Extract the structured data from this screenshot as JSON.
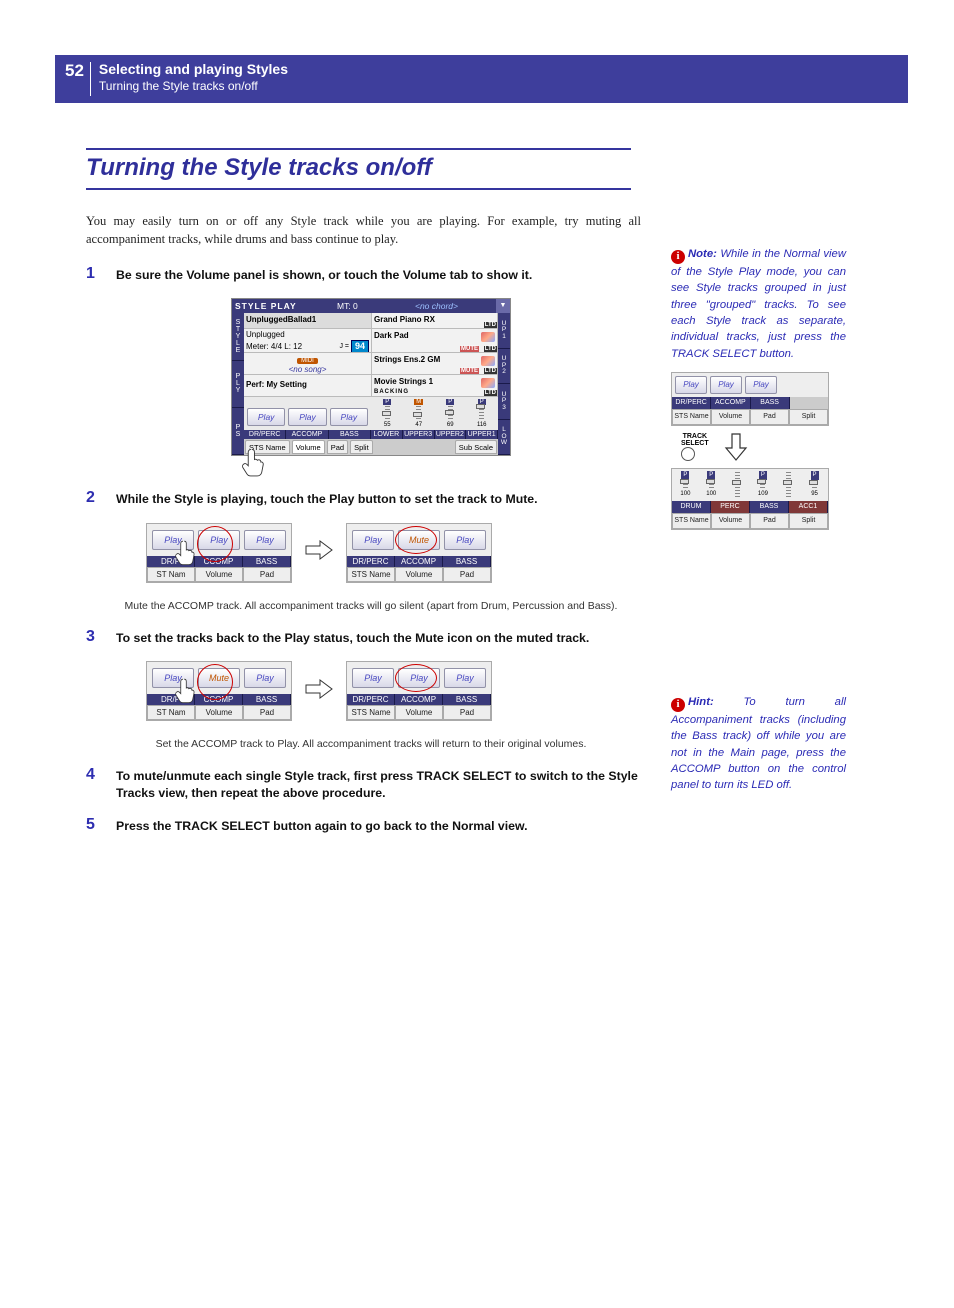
{
  "header": {
    "page_number": "52",
    "section": "Selecting and playing Styles",
    "subsection": "Turning the Style tracks on/off"
  },
  "title": "Turning the Style tracks on/off",
  "intro": "You may easily turn on or off any Style track while you are playing. For example, try muting all accompaniment tracks, while drums and bass continue to play.",
  "steps": {
    "s1": {
      "num": "1",
      "text": "Be sure the Volume panel is shown, or touch the Volume tab to show it."
    },
    "s2": {
      "num": "2",
      "text": "While the Style is playing, touch the Play button to set the track to Mute."
    },
    "s3": {
      "num": "3",
      "text": "To set the tracks back to the Play status, touch the Mute icon on the muted track."
    },
    "s4": {
      "num": "4",
      "text": "To mute/unmute each single Style track, first press TRACK SELECT to switch to the Style Tracks view, then repeat the above procedure."
    },
    "s5": {
      "num": "5",
      "text": "Press the TRACK SELECT button again to go back to the Normal view."
    }
  },
  "captions": {
    "c2": "Mute the ACCOMP track. All accompaniment tracks will go silent (apart from Drum, Percussion and Bass).",
    "c3": "Set the ACCOMP track to Play. All accompaniment tracks will return to their original volumes."
  },
  "side_notes": {
    "note1": {
      "label": "Note:",
      "text": " While in the Normal view of the Style Play mode, you can see Style tracks grouped in just three \"grouped\" tracks. To see each Style track as separate, individual tracks, just press the TRACK SELECT button."
    },
    "hint1": {
      "label": "Hint:",
      "text": " To turn all Accompaniment tracks (including the Bass track) off while you are not in the Main page, press the ACCOMP button on the control panel to turn its LED off."
    }
  },
  "fig1": {
    "title": "STYLE PLAY",
    "mt": "MT: 0",
    "chord": "<no chord>",
    "style_name": "UnpluggedBallad1",
    "meter_l": "Unplugged",
    "meter_line": "Meter: 4/4  L: 12",
    "tempo_prefix": "J =",
    "tempo": "94",
    "no_song": "<no song>",
    "perf": "Perf:  My Setting",
    "sounds": [
      "Grand Piano RX",
      "Dark Pad",
      "Strings Ens.2 GM",
      "Movie Strings 1"
    ],
    "smallsub": "BACKING",
    "play": "Play",
    "group_labels": [
      "DR/PERC",
      "ACCOMP",
      "BASS"
    ],
    "upper_labels": [
      "LOWER",
      "UPPER3",
      "UPPER2",
      "UPPER1"
    ],
    "slider_vals": [
      "55",
      "47",
      "69",
      "116"
    ],
    "slider_flags": [
      "P",
      "M",
      "P",
      "P"
    ],
    "tabs": [
      "STS Name",
      "Volume",
      "Pad",
      "Split",
      "Sub Scale"
    ],
    "left_tabs": [
      [
        "S",
        "T",
        "Y",
        "L",
        "E"
      ],
      [
        "P",
        "L",
        "Y"
      ],
      [
        "P",
        "S"
      ]
    ],
    "right_tabs": [
      [
        "U",
        "P",
        "1"
      ],
      [
        "U",
        "P",
        "2"
      ],
      [
        "U",
        "P",
        "3"
      ],
      [
        "L",
        "O",
        "W"
      ]
    ]
  },
  "mini": {
    "play": "Play",
    "mute": "Mute",
    "labels3": [
      "DR/PERC",
      "ACCOMP",
      "BASS"
    ],
    "labels3b": [
      "DR/P",
      "CCOMP",
      "BASS"
    ],
    "tabs3": [
      "STS Name",
      "Volume",
      "Pad"
    ],
    "tabs3b": [
      "ST Nam",
      "Volume",
      "Pad"
    ]
  },
  "side_fig": {
    "labels3": [
      "DR/PERC",
      "ACCOMP",
      "BASS"
    ],
    "tabs4": [
      "STS Name",
      "Volume",
      "Pad",
      "Split"
    ],
    "track_select": "TRACK SELECT",
    "slider_vals": [
      "100",
      "100",
      "",
      "109",
      "",
      "95"
    ],
    "slider_flags": [
      "P",
      "P",
      "",
      "P",
      "",
      "P"
    ],
    "labels4": [
      "DRUM",
      "PERC",
      "BASS",
      "ACC1"
    ]
  },
  "icon_glyph": "i"
}
